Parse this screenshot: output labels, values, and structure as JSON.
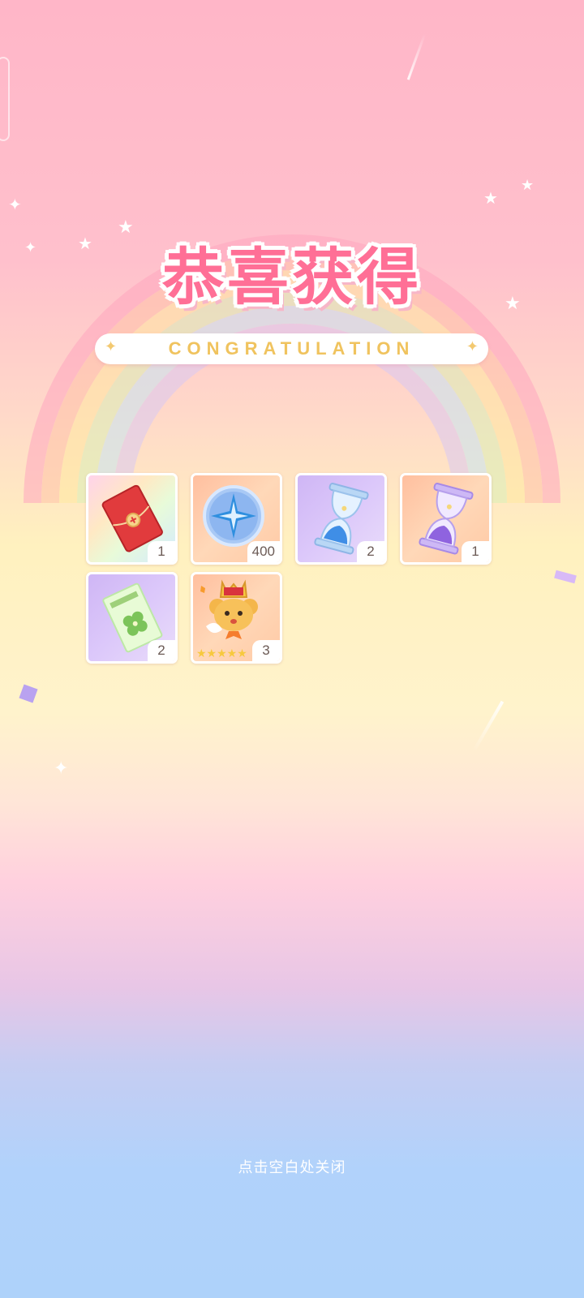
{
  "title": "恭喜获得",
  "subtitle": "CONGRATULATION",
  "rewards": [
    {
      "name": "red-envelope",
      "count": "1"
    },
    {
      "name": "star-coin",
      "count": "400"
    },
    {
      "name": "blue-hourglass",
      "count": "2"
    },
    {
      "name": "purple-hourglass",
      "count": "1"
    },
    {
      "name": "clover-ticket",
      "count": "2"
    },
    {
      "name": "kero-figure",
      "count": "3"
    }
  ],
  "close_hint": "点击空白处关闭"
}
